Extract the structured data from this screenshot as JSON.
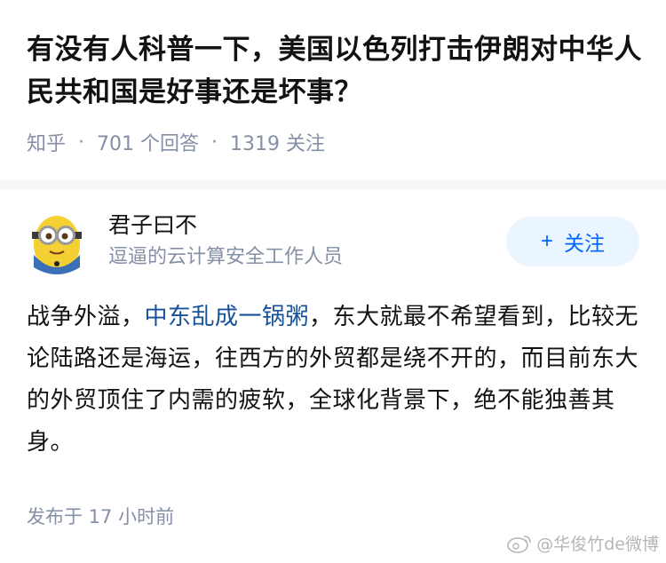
{
  "question": {
    "title": "有没有人科普一下，美国以色列打击伊朗对中华人民共和国是好事还是坏事？",
    "source": "知乎",
    "answers_count": "701 个回答",
    "followers_count": "1319 关注"
  },
  "answer": {
    "author_name": "君子曰不",
    "author_bio": "逗逼的云计算安全工作人员",
    "follow_label": "关注",
    "body_before_link": "战争外溢，",
    "body_link": "中东乱成一锅粥",
    "body_after_link": "，东大就最不希望看到，比较无论陆路还是海运，往西方的外贸都是绕不开的，而目前东大的外贸顶住了内需的疲软，全球化背景下，绝不能独善其身。",
    "posted_time": "发布于 17 小时前"
  },
  "watermark": {
    "text": "@华俊竹de微博",
    "icon": "weibo-icon"
  },
  "colors": {
    "link": "#175199",
    "accent": "#0066ff",
    "follow_bg": "#ebf5ff",
    "meta": "#8590a6"
  }
}
